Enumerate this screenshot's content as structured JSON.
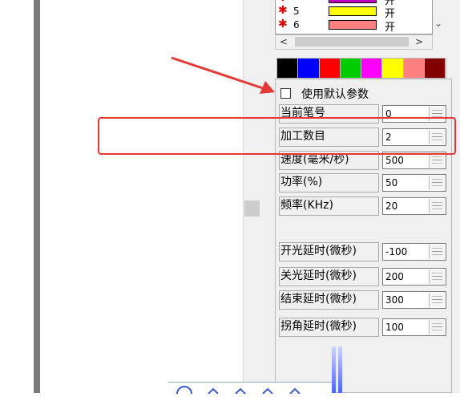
{
  "layers": [
    {
      "star": "✱",
      "number": "",
      "color": "#c000c0",
      "state": "开"
    },
    {
      "star": "✱",
      "number": "5",
      "color": "#ffff00",
      "state": "开"
    },
    {
      "star": "✱",
      "number": "6",
      "color": "#ff8080",
      "state": "开"
    }
  ],
  "scroll": {
    "left_icon": "chevron-left",
    "right_icon": "chevron-right",
    "down_icon": "chevron-down"
  },
  "palette": [
    "#000000",
    "#0000ff",
    "#ff0000",
    "#00cc00",
    "#ff00ff",
    "#ffff00",
    "#ff8080",
    "#800000"
  ],
  "params": {
    "use_default_label": "使用默认参数",
    "rows": [
      {
        "label": "当前笔号",
        "value": "0"
      },
      {
        "label": "加工数目",
        "value": "2"
      },
      {
        "label": "速度(毫米/秒)",
        "value": "500"
      },
      {
        "label": "功率(%)",
        "value": "50"
      },
      {
        "label": "频率(KHz)",
        "value": "20"
      },
      {
        "label": "开光延时(微秒)",
        "value": "-100"
      },
      {
        "label": "关光延时(微秒)",
        "value": "200"
      },
      {
        "label": "结束延时(微秒)",
        "value": "300"
      },
      {
        "label": "拐角延时(微秒)",
        "value": "100"
      }
    ]
  },
  "annotation_color": "#e53935"
}
